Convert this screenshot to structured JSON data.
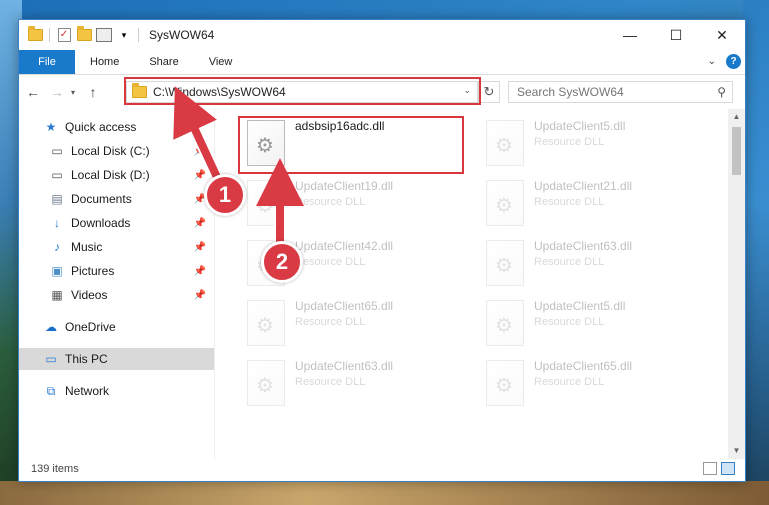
{
  "window": {
    "title": "SysWOW64",
    "controls": {
      "minimize": "—",
      "maximize": "☐",
      "close": "✕"
    }
  },
  "ribbon": {
    "tabs": [
      "File",
      "Home",
      "Share",
      "View"
    ],
    "help": "?"
  },
  "address": {
    "path": "C:\\Windows\\SysWOW64",
    "search_placeholder": "Search SysWOW64"
  },
  "nav": {
    "items": [
      {
        "label": "Quick access",
        "icon": "star-icon",
        "pinned": false
      },
      {
        "label": "Local Disk (C:)",
        "icon": "drive-icon",
        "pinned": true
      },
      {
        "label": "Local Disk (D:)",
        "icon": "drive-icon",
        "pinned": true
      },
      {
        "label": "Documents",
        "icon": "documents-icon",
        "pinned": true
      },
      {
        "label": "Downloads",
        "icon": "downloads-icon",
        "pinned": true
      },
      {
        "label": "Music",
        "icon": "music-icon",
        "pinned": true
      },
      {
        "label": "Pictures",
        "icon": "pictures-icon",
        "pinned": true
      },
      {
        "label": "Videos",
        "icon": "videos-icon",
        "pinned": true
      },
      {
        "label": "OneDrive",
        "icon": "onedrive-icon",
        "pinned": false
      },
      {
        "label": "This PC",
        "icon": "pc-icon",
        "pinned": false,
        "selected": true
      },
      {
        "label": "Network",
        "icon": "network-icon",
        "pinned": false
      }
    ]
  },
  "files": [
    {
      "name": "adsbsip16adc.dll",
      "type": "",
      "highlighted": true
    },
    {
      "name": "UpdateClient5.dll",
      "type": "Resource DLL"
    },
    {
      "name": "UpdateClient19.dll",
      "type": "Resource DLL"
    },
    {
      "name": "UpdateClient21.dll",
      "type": "Resource DLL"
    },
    {
      "name": "UpdateClient42.dll",
      "type": "Resource DLL"
    },
    {
      "name": "UpdateClient63.dll",
      "type": "Resource DLL"
    },
    {
      "name": "UpdateClient65.dll",
      "type": "Resource DLL"
    },
    {
      "name": "UpdateClient5.dll",
      "type": "Resource DLL"
    },
    {
      "name": "UpdateClient63.dll",
      "type": "Resource DLL"
    },
    {
      "name": "UpdateClient65.dll",
      "type": "Resource DLL"
    }
  ],
  "status": {
    "items": "139 items"
  },
  "annotations": {
    "badge1": "1",
    "badge2": "2"
  },
  "colors": {
    "accent": "#1979ca",
    "highlight": "#d9363e",
    "badge": "#d93a43"
  }
}
